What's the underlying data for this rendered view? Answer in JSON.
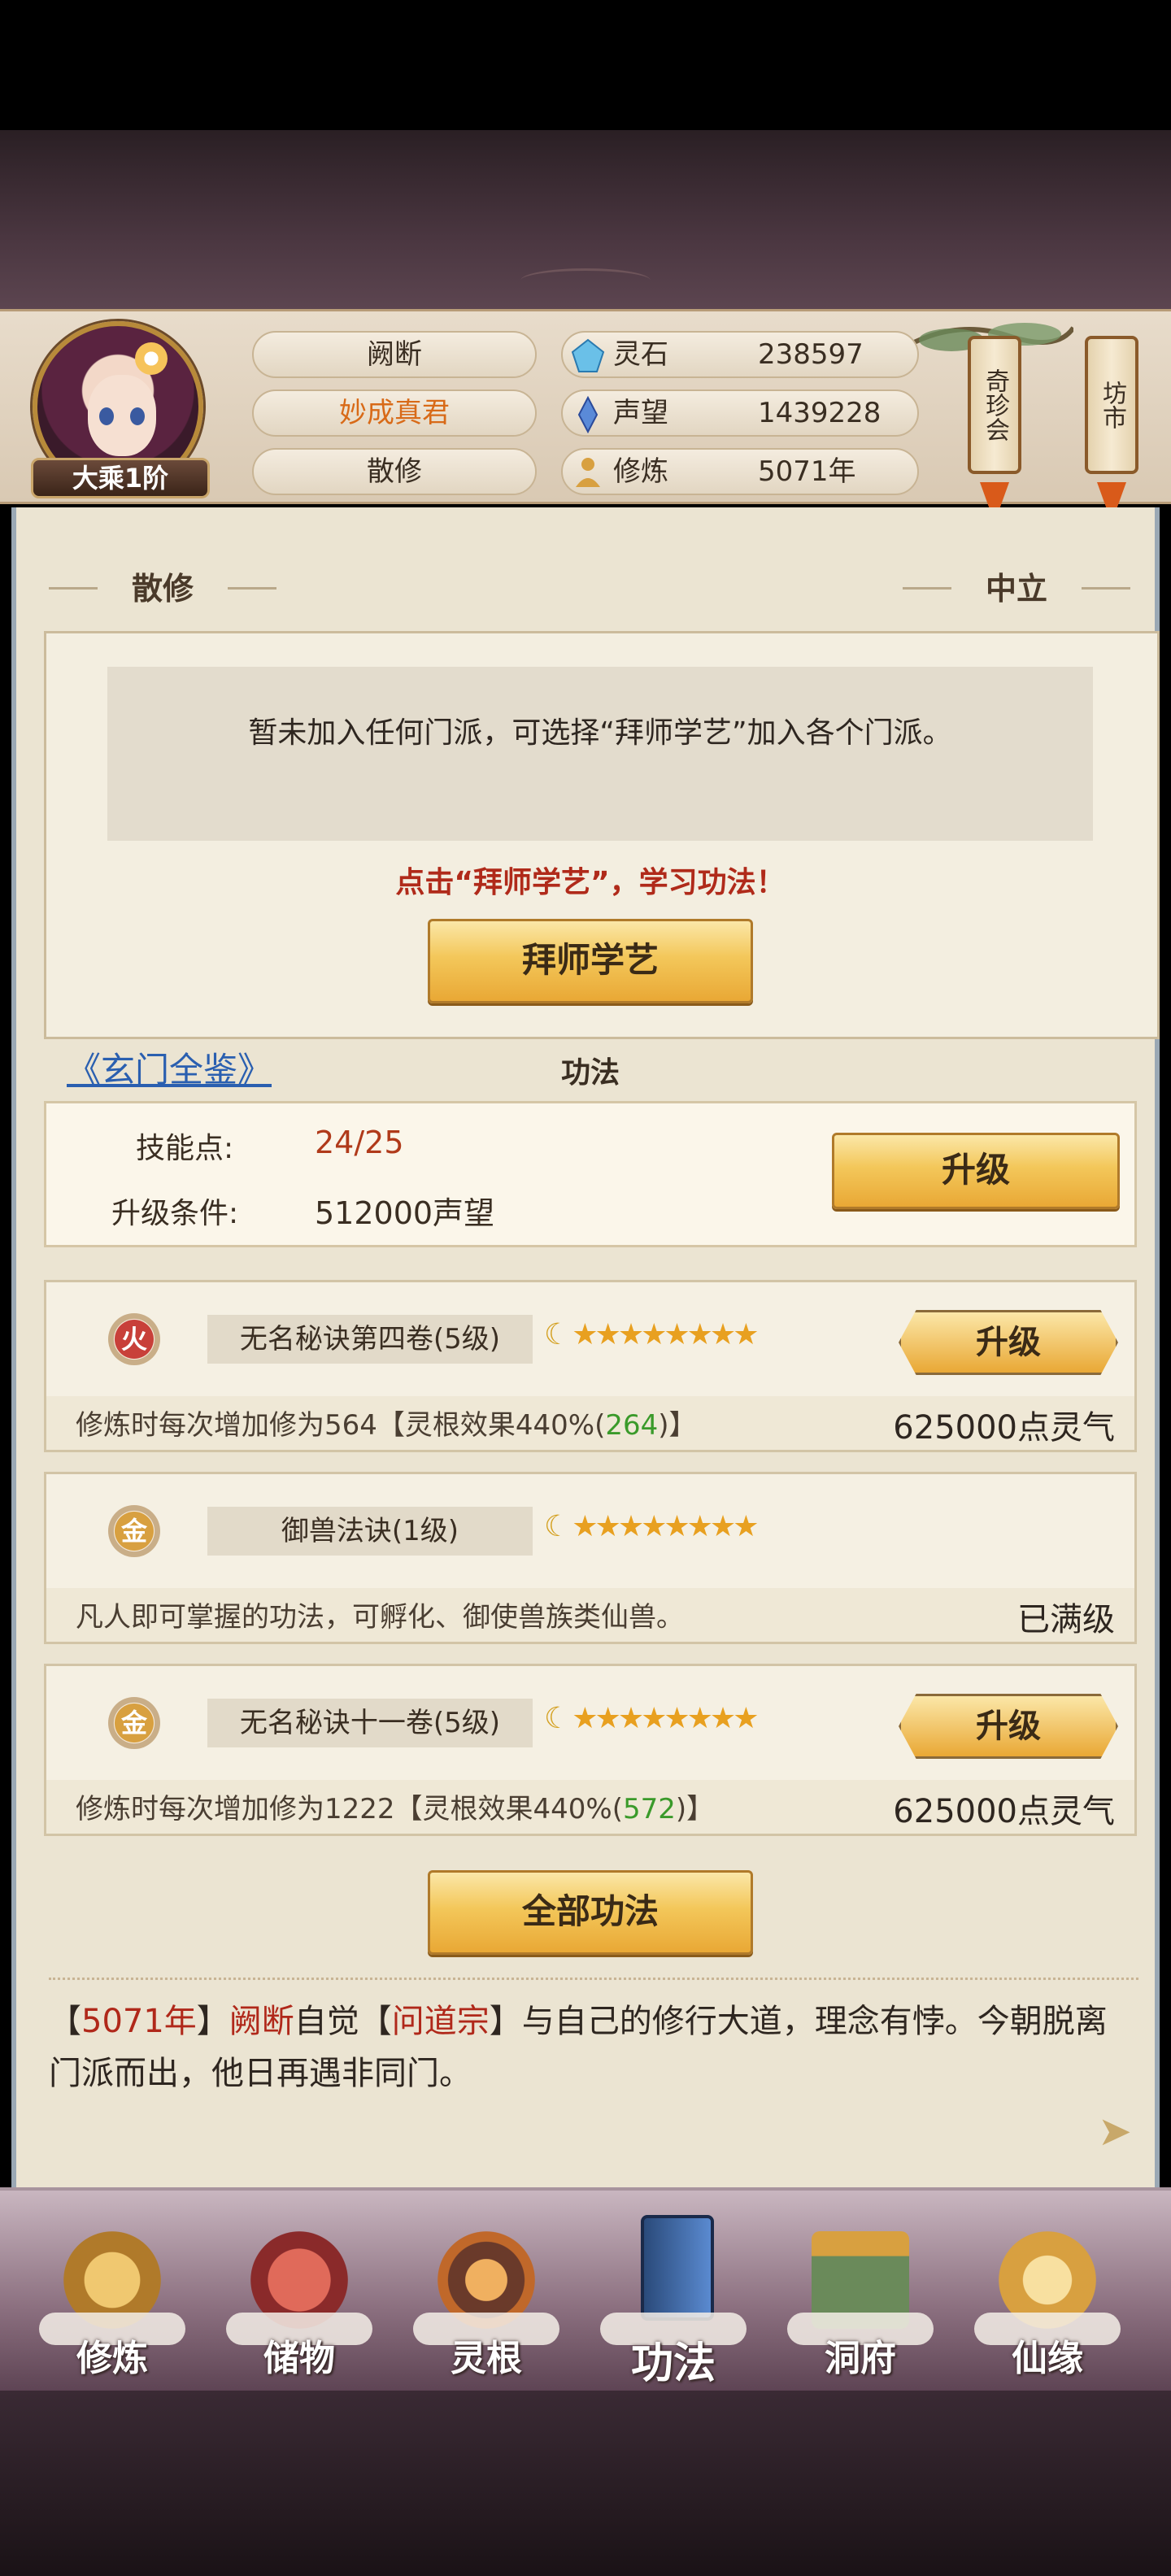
{
  "header": {
    "rank": "大乘1阶",
    "player_name": "阙断",
    "title": "妙成真君",
    "sect": "散修",
    "resources": [
      {
        "icon": "spirit-stone-icon",
        "label": "灵石",
        "value": "238597"
      },
      {
        "icon": "reputation-icon",
        "label": "声望",
        "value": "1439228"
      },
      {
        "icon": "cultivation-icon",
        "label": "修炼",
        "value": "5071年"
      }
    ],
    "side_scrolls": [
      "奇珍会",
      "坊市"
    ]
  },
  "sect_panel": {
    "left_label": "散修",
    "right_label": "中立",
    "notice": "暂未加入任何门派，可选择“拜师学艺”加入各个门派。",
    "hint": "点击“拜师学艺”，学习功法！",
    "button": "拜师学艺"
  },
  "techniques": {
    "link": "《玄门全鉴》",
    "title": "功法",
    "skill_points_label": "技能点:",
    "skill_points": "24/25",
    "upgrade_cond_label": "升级条件:",
    "upgrade_cond": "512000声望",
    "upgrade_button": "升级",
    "items": [
      {
        "element": "火",
        "element_color": "#c8403a",
        "name": "无名秘诀第四卷(5级)",
        "stars": "★★★★★★★★",
        "button": "升级",
        "desc_pre": "修炼时每次增加修为564【灵根效果440%(",
        "desc_green": "264",
        "desc_post": ")】",
        "cost": "625000点灵气"
      },
      {
        "element": "金",
        "element_color": "#d8a040",
        "name": "御兽法诀(1级)",
        "stars": "★★★★★★★★",
        "button": "",
        "desc_pre": "凡人即可掌握的功法，可孵化、御使兽族类仙兽。",
        "desc_green": "",
        "desc_post": "",
        "cost": "已满级"
      },
      {
        "element": "金",
        "element_color": "#d8a040",
        "name": "无名秘诀十一卷(5级)",
        "stars": "★★★★★★★★",
        "button": "升级",
        "desc_pre": "修炼时每次增加修为1222【灵根效果440%(",
        "desc_green": "572",
        "desc_post": ")】",
        "cost": "625000点灵气"
      }
    ],
    "all_button": "全部功法"
  },
  "log": {
    "b1": "【",
    "year": "5071年",
    "b2": "】",
    "name": "阙断",
    "t1": "自觉【",
    "sect": "问道宗",
    "t2": "】与自己的修行大道，理念有悖。今朝脱离门派而出，他日再遇非同门。"
  },
  "nav": [
    {
      "label": "修炼",
      "icon": "cultivate-icon",
      "color": "#d8a040"
    },
    {
      "label": "储物",
      "icon": "storage-bag-icon",
      "color": "#c0483a"
    },
    {
      "label": "灵根",
      "icon": "spirit-root-icon",
      "color": "#c0682a"
    },
    {
      "label": "功法",
      "icon": "technique-book-icon",
      "color": "#4a7ab8"
    },
    {
      "label": "洞府",
      "icon": "cave-abode-icon",
      "color": "#6a8a5a"
    },
    {
      "label": "仙缘",
      "icon": "fortune-icon",
      "color": "#e0b860"
    }
  ]
}
